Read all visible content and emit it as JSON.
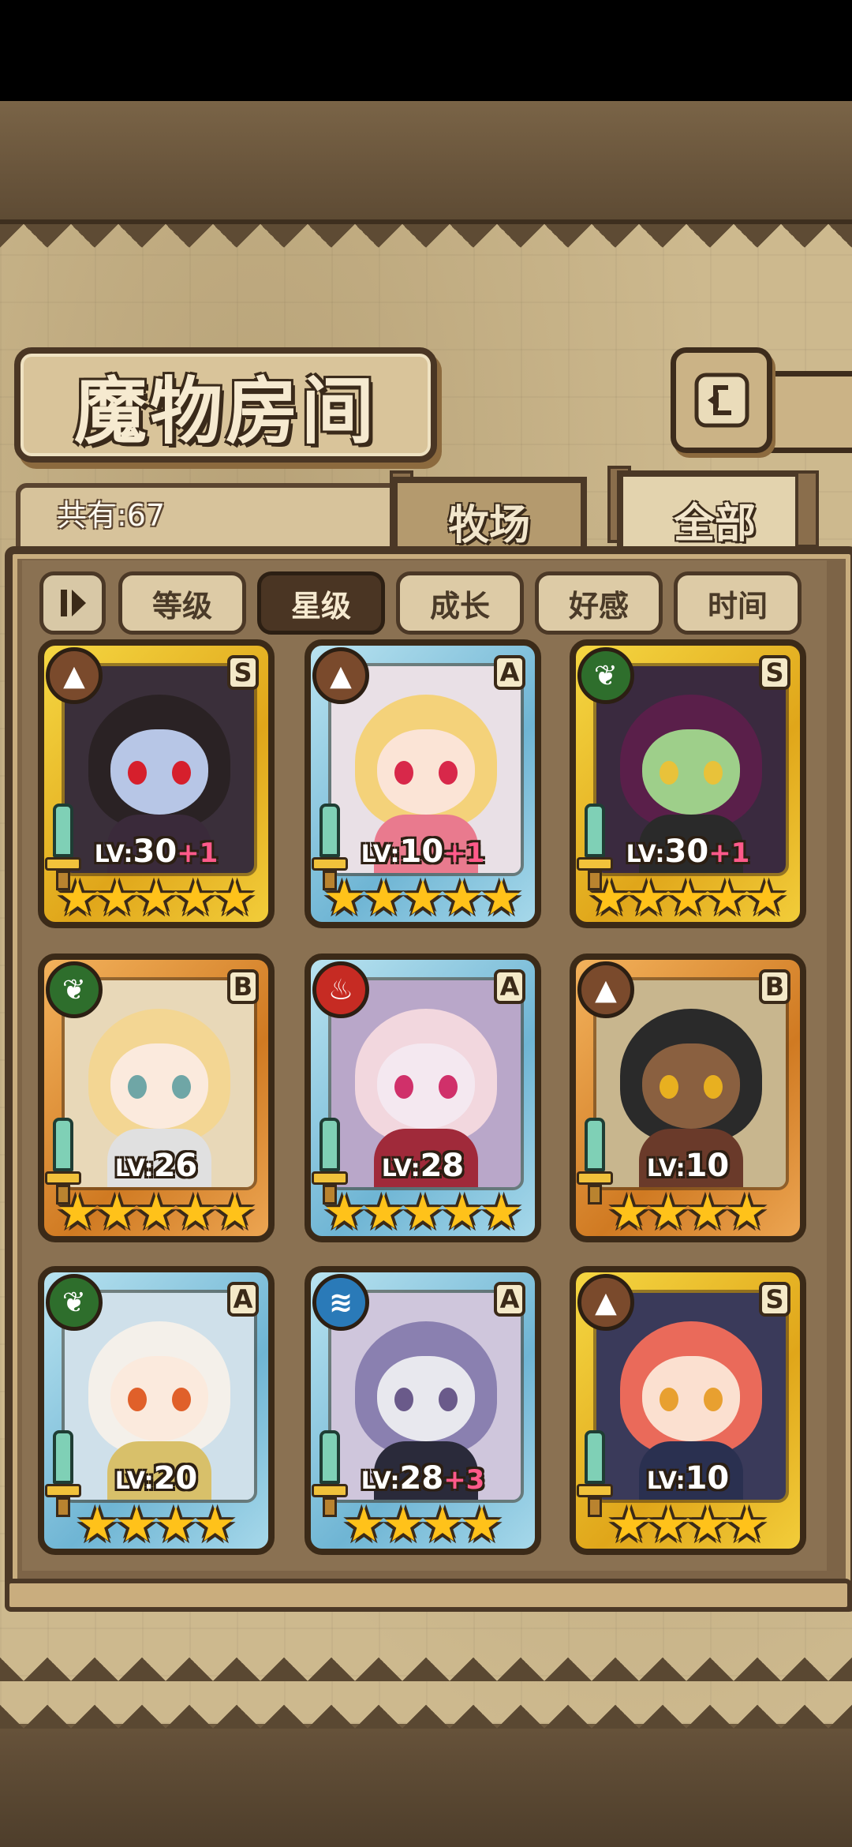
{
  "title": "魔物房间",
  "count_text": "共有:67",
  "tabs": [
    {
      "label": "牧场"
    },
    {
      "label": "全部"
    }
  ],
  "sort_buttons": [
    {
      "label": "等级",
      "active": false
    },
    {
      "label": "星级",
      "active": true
    },
    {
      "label": "成长",
      "active": false
    },
    {
      "label": "好感",
      "active": false
    },
    {
      "label": "时间",
      "active": false
    }
  ],
  "back_icon": "return-arrow-icon",
  "monsters": [
    {
      "element": "earth-icon",
      "rank": "S",
      "level": "30",
      "bonus": "+1",
      "stars": 5,
      "frame": "gold"
    },
    {
      "element": "earth-icon",
      "rank": "A",
      "level": "10",
      "bonus": "+1",
      "stars": 5,
      "frame": "blue"
    },
    {
      "element": "wood-icon",
      "rank": "S",
      "level": "30",
      "bonus": "+1",
      "stars": 5,
      "frame": "gold"
    },
    {
      "element": "wood-icon",
      "rank": "B",
      "level": "26",
      "bonus": "",
      "stars": 5,
      "frame": "bronze"
    },
    {
      "element": "fire-icon",
      "rank": "A",
      "level": "28",
      "bonus": "",
      "stars": 5,
      "frame": "blue"
    },
    {
      "element": "earth-icon",
      "rank": "B",
      "level": "10",
      "bonus": "",
      "stars": 4,
      "frame": "bronze"
    },
    {
      "element": "wood-icon",
      "rank": "A",
      "level": "20",
      "bonus": "",
      "stars": 4,
      "frame": "blue"
    },
    {
      "element": "water-icon",
      "rank": "A",
      "level": "28",
      "bonus": "+3",
      "stars": 4,
      "frame": "blue"
    },
    {
      "element": "earth-icon",
      "rank": "S",
      "level": "10",
      "bonus": "",
      "stars": 4,
      "frame": "gold"
    }
  ],
  "level_prefix": "LV:"
}
